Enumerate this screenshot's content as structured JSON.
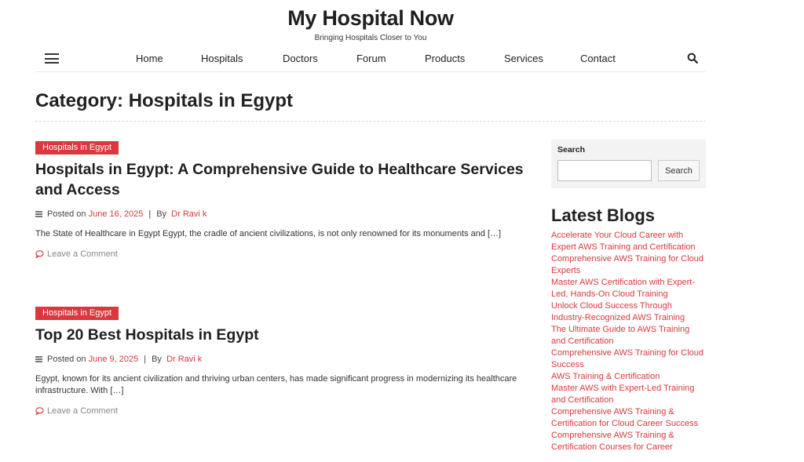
{
  "header": {
    "site_title": "My Hospital Now",
    "tagline": "Bringing Hospitals Closer to You"
  },
  "nav": {
    "menu_icon": "hamburger-icon",
    "search_icon": "search-icon",
    "items": [
      {
        "label": "Home"
      },
      {
        "label": "Hospitals"
      },
      {
        "label": "Doctors"
      },
      {
        "label": "Forum"
      },
      {
        "label": "Products"
      },
      {
        "label": "Services"
      },
      {
        "label": "Contact"
      }
    ]
  },
  "page": {
    "title": "Category: Hospitals in Egypt"
  },
  "posts": [
    {
      "category": "Hospitals in Egypt",
      "title": "Hospitals in Egypt: A Comprehensive Guide to Healthcare Services and Access",
      "posted_on_label": "Posted on",
      "date": "June 16, 2025",
      "separator": "|",
      "by_label": "By",
      "author": "Dr Ravi k",
      "excerpt": "The State of Healthcare in Egypt Egypt, the cradle of ancient civilizations, is not only renowned for its monuments and […]",
      "comment_label": "Leave a Comment"
    },
    {
      "category": "Hospitals in Egypt",
      "title": "Top 20 Best Hospitals in Egypt",
      "posted_on_label": "Posted on",
      "date": "June 9, 2025",
      "separator": "|",
      "by_label": "By",
      "author": "Dr Ravi k",
      "excerpt": "Egypt, known for its ancient civilization and thriving urban centers, has made significant progress in modernizing its healthcare infrastructure. With […]",
      "comment_label": "Leave a Comment"
    }
  ],
  "sidebar": {
    "search": {
      "label": "Search",
      "value": "",
      "button_label": "Search"
    },
    "latest_heading": "Latest Blogs",
    "latest_items": [
      "Accelerate Your Cloud Career with Expert AWS Training and Certification",
      "Comprehensive AWS Training for Cloud Experts",
      "Master AWS Certification with Expert-Led, Hands-On Cloud Training",
      "Unlock Cloud Success Through Industry-Recognized AWS Training",
      "The Ultimate Guide to AWS Training and Certification",
      "Comprehensive AWS Training for Cloud Success",
      "AWS Training & Certification",
      "Master AWS with Expert-Led Training and Certification",
      "Comprehensive AWS Training & Certification for Cloud Career Success",
      "Comprehensive AWS Training & Certification Courses for Career"
    ]
  },
  "colors": {
    "accent": "#d9393e",
    "text": "#222222",
    "muted": "#888888",
    "widget_bg": "#f3f3f3"
  }
}
